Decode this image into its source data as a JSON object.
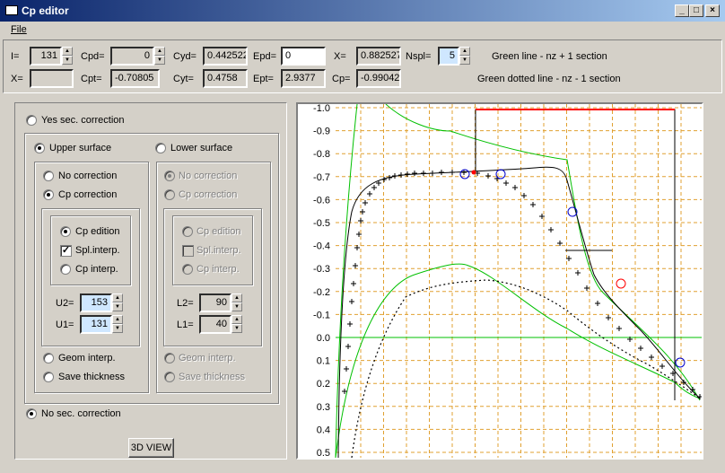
{
  "window": {
    "title": "Cp editor"
  },
  "menu": {
    "file": "File"
  },
  "top": {
    "i_label": "I=",
    "i_value": "131",
    "cpd_label": "Cpd=",
    "cpd_value": "0",
    "cyd_label": "Cyd=",
    "cyd_value": "0.442522",
    "epd_label": "Epd=",
    "epd_value": "0",
    "x1_label": "X=",
    "x1_value": "0.882527",
    "nspl_label": "Nspl=",
    "nspl_value": "5",
    "legend_green": "Green line - nz + 1 section",
    "x2_label": "X=",
    "x2_value": "",
    "cpt_label": "Cpt=",
    "cpt_value": "-0.70805",
    "cyt_label": "Cyt=",
    "cyt_value": "0.4758",
    "ept_label": "Ept=",
    "ept_value": "2.9377",
    "cp_label": "Cp=",
    "cp_value": "-0.99042",
    "legend_dotted": "Green dotted line - nz - 1 section"
  },
  "left": {
    "yes_sec": "Yes sec. correction",
    "upper": "Upper surface",
    "lower": "Lower surface",
    "u_no_corr": "No correction",
    "u_cp_corr": "Cp correction",
    "u_cp_edition": "Cp edition",
    "u_spl": "Spl.interp.",
    "u_cp_interp": "Cp interp.",
    "u2_label": "U2=",
    "u2_value": "153",
    "u1_label": "U1=",
    "u1_value": "131",
    "u_geom": "Geom interp.",
    "u_save": "Save thickness",
    "l_no_corr": "No correction",
    "l_cp_corr": "Cp correction",
    "l_cp_edition": "Cp edition",
    "l_spl": "Spl.interp.",
    "l_cp_interp": "Cp interp.",
    "l2_label": "L2=",
    "l2_value": "90",
    "l1_label": "L1=",
    "l1_value": "40",
    "l_geom": "Geom interp.",
    "l_save": "Save thickness",
    "no_sec": "No sec. correction",
    "view3d": "3D VIEW"
  },
  "chart_data": {
    "type": "line",
    "y_ticks": [
      "-1.0",
      "-0.9",
      "-0.8",
      "-0.7",
      "-0.6",
      "-0.5",
      "-0.4",
      "-0.3",
      "-0.2",
      "-0.1",
      "0.0",
      "0.1",
      "0.2",
      "0.3",
      "0.4",
      "0.5"
    ],
    "ylim": [
      -1.0,
      0.55
    ],
    "grid": true,
    "colors": {
      "grid": "#e0a030",
      "green": "#00c000",
      "black": "#000000",
      "red": "#ff0000",
      "blue": "#0000cc"
    }
  }
}
